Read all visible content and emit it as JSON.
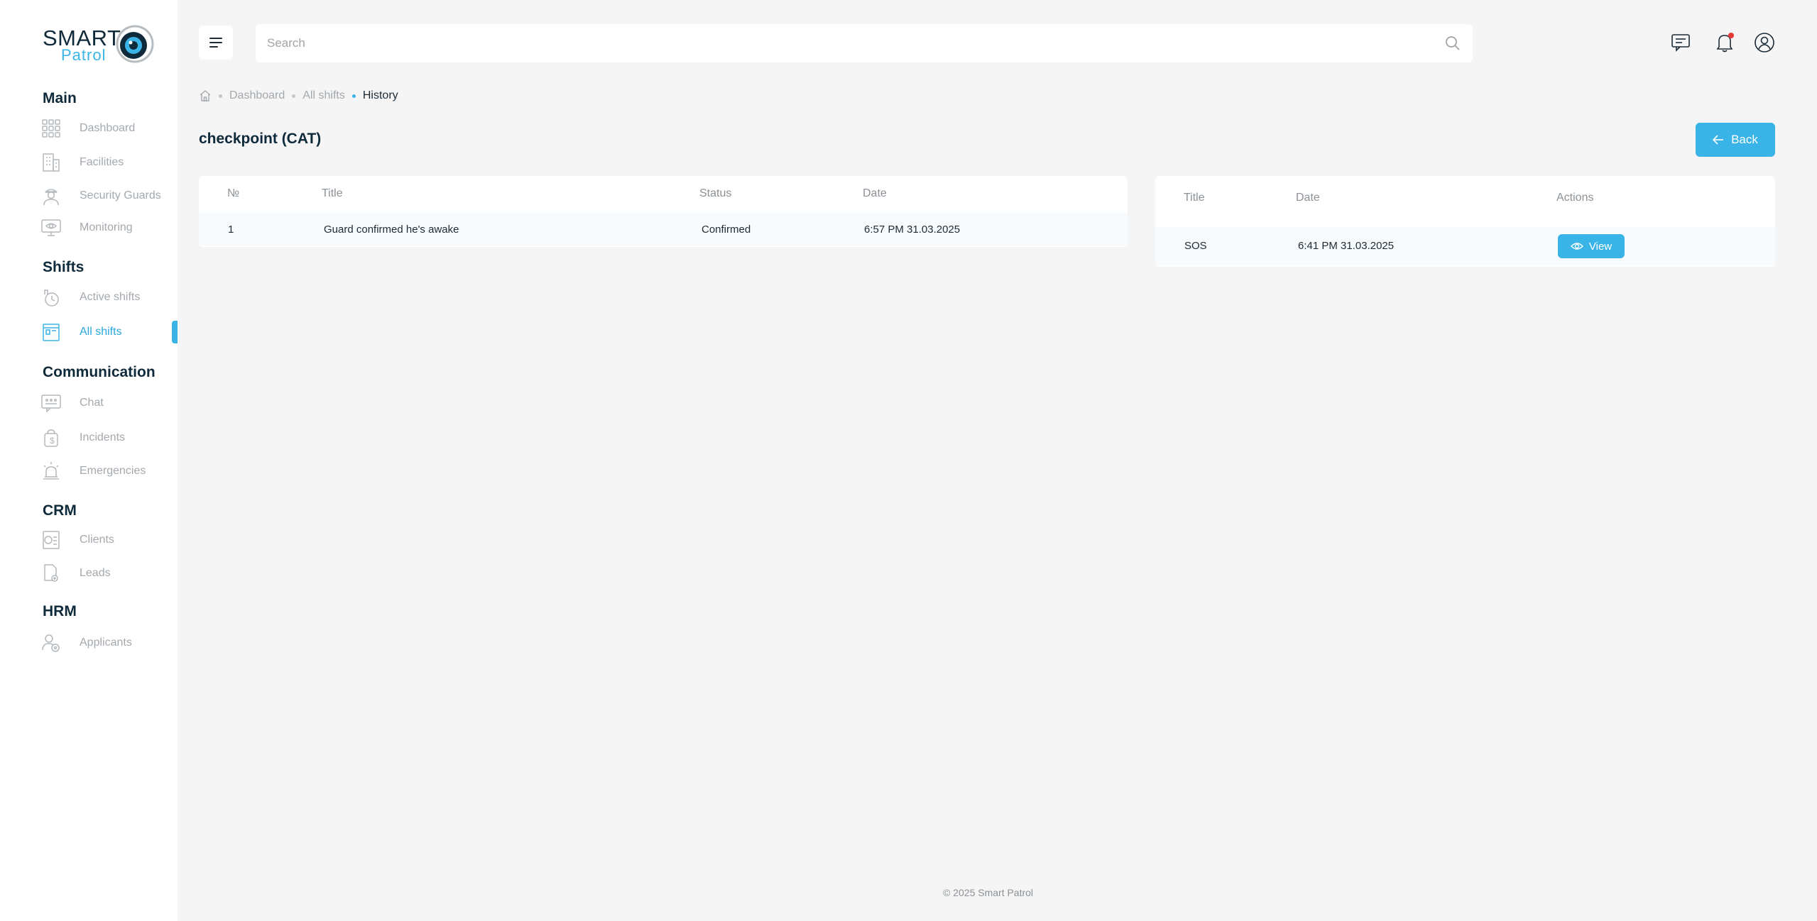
{
  "logo": {
    "line1": "SMART",
    "line2": "Patrol"
  },
  "sidebar": {
    "sections": [
      {
        "title": "Main"
      },
      {
        "title": "Shifts"
      },
      {
        "title": "Communication"
      },
      {
        "title": "CRM"
      },
      {
        "title": "HRM"
      }
    ],
    "items": [
      {
        "label": "Dashboard",
        "icon": "grid-icon"
      },
      {
        "label": "Facilities",
        "icon": "building-icon"
      },
      {
        "label": "Security Guards",
        "icon": "guard-icon"
      },
      {
        "label": "Monitoring",
        "icon": "monitor-eye-icon"
      },
      {
        "label": "Active shifts",
        "icon": "hand-clock-icon"
      },
      {
        "label": "All shifts",
        "icon": "board-icon",
        "active": true
      },
      {
        "label": "Chat",
        "icon": "chat-icon"
      },
      {
        "label": "Incidents",
        "icon": "incident-icon"
      },
      {
        "label": "Emergencies",
        "icon": "siren-icon"
      },
      {
        "label": "Clients",
        "icon": "clients-icon"
      },
      {
        "label": "Leads",
        "icon": "lead-document-icon"
      },
      {
        "label": "Applicants",
        "icon": "applicant-icon"
      }
    ]
  },
  "search": {
    "placeholder": "Search",
    "value": ""
  },
  "breadcrumb": {
    "items": [
      "Dashboard",
      "All shifts",
      "History"
    ]
  },
  "page": {
    "title": "checkpoint (CAT)",
    "back_label": "Back"
  },
  "history_table": {
    "headers": [
      "№",
      "Title",
      "Status",
      "Date"
    ],
    "rows": [
      {
        "num": "1",
        "title": "Guard confirmed he's awake",
        "status": "Confirmed",
        "date": "6:57 PM 31.03.2025"
      }
    ]
  },
  "alerts_table": {
    "headers": [
      "Title",
      "Date",
      "Actions"
    ],
    "rows": [
      {
        "title": "SOS",
        "date": "6:41 PM 31.03.2025",
        "action": "View"
      }
    ]
  },
  "footer": {
    "text": "© 2025 Smart Patrol"
  },
  "colors": {
    "accent": "#3ab4e6",
    "notification": "#e53935",
    "heading": "#0f2a3a"
  }
}
